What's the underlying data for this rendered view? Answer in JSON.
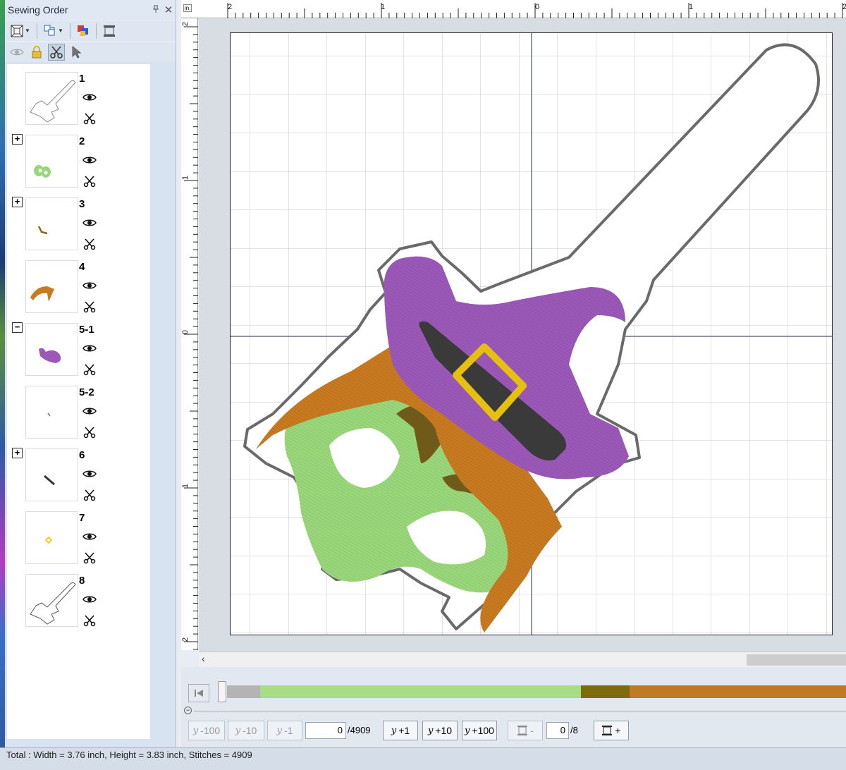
{
  "panel": {
    "title": "Sewing Order",
    "items": [
      {
        "label": "1",
        "expander": "",
        "color": "#888888",
        "icon": "holder-outline"
      },
      {
        "label": "2",
        "expander": "+",
        "color": "#9ad77a",
        "icon": "green-eyes"
      },
      {
        "label": "3",
        "expander": "+",
        "color": "#8a6a10",
        "icon": "brow"
      },
      {
        "label": "4",
        "expander": "",
        "color": "#c87a20",
        "icon": "hair"
      },
      {
        "label": "5-1",
        "expander": "−",
        "color": "#9c58b8",
        "icon": "hat"
      },
      {
        "label": "5-2",
        "expander": "",
        "color": "#9c58b8",
        "icon": "dash"
      },
      {
        "label": "6",
        "expander": "+",
        "color": "#333333",
        "icon": "band"
      },
      {
        "label": "7",
        "expander": "",
        "color": "#f0d020",
        "icon": "buckle"
      },
      {
        "label": "8",
        "expander": "",
        "color": "#555555",
        "icon": "holder-outline"
      }
    ]
  },
  "ruler": {
    "unit": "in.",
    "top_labels": [
      "2",
      "1",
      "0",
      "1",
      "2"
    ],
    "left_labels": [
      "2",
      "1",
      "0",
      "1",
      "2"
    ]
  },
  "player": {
    "buttons": {
      "minus100": "-100",
      "minus10": "-10",
      "minus1": "-1",
      "plus1": "+1",
      "plus10": "+10",
      "plus100": "+100",
      "color_minus": "-",
      "color_plus": "+"
    },
    "stitch_current": "0",
    "stitch_total": "/4909",
    "color_current": "0",
    "color_total": "/8",
    "colors": [
      {
        "name": "gray",
        "hex": "#b4b4b4",
        "fraction": 0.054
      },
      {
        "name": "green",
        "hex": "#a8dd85",
        "fraction": 0.518
      },
      {
        "name": "olive",
        "hex": "#7d6c0e",
        "fraction": 0.078
      },
      {
        "name": "orange",
        "hex": "#c07a25",
        "fraction": 0.35
      }
    ]
  },
  "status": "Total : Width = 3.76 inch, Height = 3.83 inch, Stitches = 4909"
}
